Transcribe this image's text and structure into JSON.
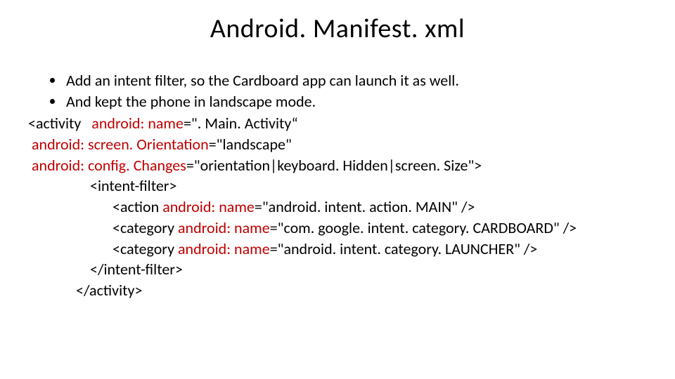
{
  "title": "Android. Manifest. xml",
  "bullets": [
    "Add an intent filter, so the Cardboard app can launch it as well.",
    "And kept the phone in landscape mode."
  ],
  "code": {
    "l1_open": "<activity   ",
    "l1_attr": "android: name",
    "l1_rest": "=\". Main. Activity“",
    "l2_attr": " android: screen. Orientation",
    "l2_rest": "=\"landscape\"",
    "l3_attr": " android: config. Changes",
    "l3_rest": "=\"orientation|keyboard. Hidden|screen. Size\">",
    "l4": "<intent-filter>",
    "l5_a": "<action ",
    "l5_b": "android: name",
    "l5_c": "=\"android. intent. action. MAIN\" />",
    "l6_a": "<category ",
    "l6_b": "android: name",
    "l6_c": "=\"com. google. intent. category. CARDBOARD\" />",
    "l7_a": "<category ",
    "l7_b": "android: name",
    "l7_c": "=\"android. intent. category. LAUNCHER\" />",
    "l8": "</intent-filter>",
    "l9": "</activity>"
  }
}
